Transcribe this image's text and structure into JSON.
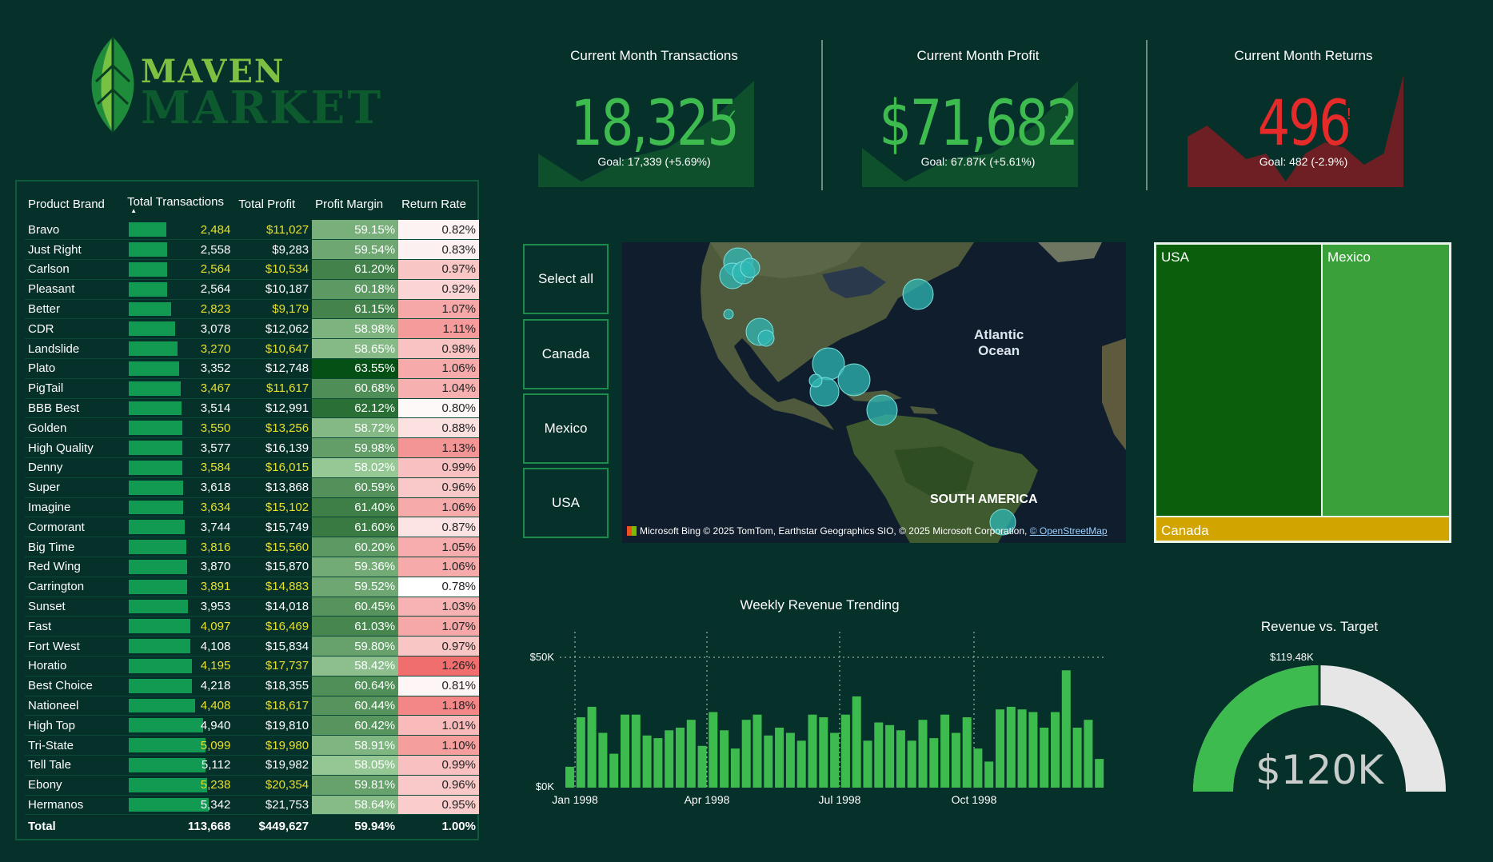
{
  "logo": {
    "word1": "MAVEN",
    "word2": "MARKET"
  },
  "table": {
    "headers": {
      "brand": "Product Brand",
      "transactions": "Total Transactions",
      "profit": "Total Profit",
      "margin": "Profit Margin",
      "return_rate": "Return Rate"
    },
    "sort_indicator": "▲",
    "rows": [
      {
        "brand": "Bravo",
        "transactions": "2,484",
        "profit": "$11,027",
        "margin": "59.15%",
        "return_rate": "0.82%",
        "tx_value": 2484,
        "margin_value": 59.15,
        "return_value": 0.82,
        "highlight": true
      },
      {
        "brand": "Just Right",
        "transactions": "2,558",
        "profit": "$9,283",
        "margin": "59.54%",
        "return_rate": "0.83%",
        "tx_value": 2558,
        "margin_value": 59.54,
        "return_value": 0.83,
        "highlight": false
      },
      {
        "brand": "Carlson",
        "transactions": "2,564",
        "profit": "$10,534",
        "margin": "61.20%",
        "return_rate": "0.97%",
        "tx_value": 2564,
        "margin_value": 61.2,
        "return_value": 0.97,
        "highlight": true
      },
      {
        "brand": "Pleasant",
        "transactions": "2,564",
        "profit": "$10,187",
        "margin": "60.18%",
        "return_rate": "0.92%",
        "tx_value": 2564,
        "margin_value": 60.18,
        "return_value": 0.92,
        "highlight": false
      },
      {
        "brand": "Better",
        "transactions": "2,823",
        "profit": "$9,179",
        "margin": "61.15%",
        "return_rate": "1.07%",
        "tx_value": 2823,
        "margin_value": 61.15,
        "return_value": 1.07,
        "highlight": true
      },
      {
        "brand": "CDR",
        "transactions": "3,078",
        "profit": "$12,062",
        "margin": "58.98%",
        "return_rate": "1.11%",
        "tx_value": 3078,
        "margin_value": 58.98,
        "return_value": 1.11,
        "highlight": false
      },
      {
        "brand": "Landslide",
        "transactions": "3,270",
        "profit": "$10,647",
        "margin": "58.65%",
        "return_rate": "0.98%",
        "tx_value": 3270,
        "margin_value": 58.65,
        "return_value": 0.98,
        "highlight": true
      },
      {
        "brand": "Plato",
        "transactions": "3,352",
        "profit": "$12,748",
        "margin": "63.55%",
        "return_rate": "1.06%",
        "tx_value": 3352,
        "margin_value": 63.55,
        "return_value": 1.06,
        "highlight": false
      },
      {
        "brand": "PigTail",
        "transactions": "3,467",
        "profit": "$11,617",
        "margin": "60.68%",
        "return_rate": "1.04%",
        "tx_value": 3467,
        "margin_value": 60.68,
        "return_value": 1.04,
        "highlight": true
      },
      {
        "brand": "BBB Best",
        "transactions": "3,514",
        "profit": "$12,991",
        "margin": "62.12%",
        "return_rate": "0.80%",
        "tx_value": 3514,
        "margin_value": 62.12,
        "return_value": 0.8,
        "highlight": false
      },
      {
        "brand": "Golden",
        "transactions": "3,550",
        "profit": "$13,256",
        "margin": "58.72%",
        "return_rate": "0.88%",
        "tx_value": 3550,
        "margin_value": 58.72,
        "return_value": 0.88,
        "highlight": true
      },
      {
        "brand": "High Quality",
        "transactions": "3,577",
        "profit": "$16,139",
        "margin": "59.98%",
        "return_rate": "1.13%",
        "tx_value": 3577,
        "margin_value": 59.98,
        "return_value": 1.13,
        "highlight": false
      },
      {
        "brand": "Denny",
        "transactions": "3,584",
        "profit": "$16,015",
        "margin": "58.02%",
        "return_rate": "0.99%",
        "tx_value": 3584,
        "margin_value": 58.02,
        "return_value": 0.99,
        "highlight": true
      },
      {
        "brand": "Super",
        "transactions": "3,618",
        "profit": "$13,868",
        "margin": "60.59%",
        "return_rate": "0.96%",
        "tx_value": 3618,
        "margin_value": 60.59,
        "return_value": 0.96,
        "highlight": false
      },
      {
        "brand": "Imagine",
        "transactions": "3,634",
        "profit": "$15,102",
        "margin": "61.40%",
        "return_rate": "1.06%",
        "tx_value": 3634,
        "margin_value": 61.4,
        "return_value": 1.06,
        "highlight": true
      },
      {
        "brand": "Cormorant",
        "transactions": "3,744",
        "profit": "$15,749",
        "margin": "61.60%",
        "return_rate": "0.87%",
        "tx_value": 3744,
        "margin_value": 61.6,
        "return_value": 0.87,
        "highlight": false
      },
      {
        "brand": "Big Time",
        "transactions": "3,816",
        "profit": "$15,560",
        "margin": "60.20%",
        "return_rate": "1.05%",
        "tx_value": 3816,
        "margin_value": 60.2,
        "return_value": 1.05,
        "highlight": true
      },
      {
        "brand": "Red Wing",
        "transactions": "3,870",
        "profit": "$15,870",
        "margin": "59.36%",
        "return_rate": "1.06%",
        "tx_value": 3870,
        "margin_value": 59.36,
        "return_value": 1.06,
        "highlight": false
      },
      {
        "brand": "Carrington",
        "transactions": "3,891",
        "profit": "$14,883",
        "margin": "59.52%",
        "return_rate": "0.78%",
        "tx_value": 3891,
        "margin_value": 59.52,
        "return_value": 0.78,
        "highlight": true
      },
      {
        "brand": "Sunset",
        "transactions": "3,953",
        "profit": "$14,018",
        "margin": "60.45%",
        "return_rate": "1.03%",
        "tx_value": 3953,
        "margin_value": 60.45,
        "return_value": 1.03,
        "highlight": false
      },
      {
        "brand": "Fast",
        "transactions": "4,097",
        "profit": "$16,469",
        "margin": "61.03%",
        "return_rate": "1.07%",
        "tx_value": 4097,
        "margin_value": 61.03,
        "return_value": 1.07,
        "highlight": true
      },
      {
        "brand": "Fort West",
        "transactions": "4,108",
        "profit": "$15,834",
        "margin": "59.80%",
        "return_rate": "0.97%",
        "tx_value": 4108,
        "margin_value": 59.8,
        "return_value": 0.97,
        "highlight": false
      },
      {
        "brand": "Horatio",
        "transactions": "4,195",
        "profit": "$17,737",
        "margin": "58.42%",
        "return_rate": "1.26%",
        "tx_value": 4195,
        "margin_value": 58.42,
        "return_value": 1.26,
        "highlight": true
      },
      {
        "brand": "Best Choice",
        "transactions": "4,218",
        "profit": "$18,355",
        "margin": "60.64%",
        "return_rate": "0.81%",
        "tx_value": 4218,
        "margin_value": 60.64,
        "return_value": 0.81,
        "highlight": false
      },
      {
        "brand": "Nationeel",
        "transactions": "4,408",
        "profit": "$18,617",
        "margin": "60.44%",
        "return_rate": "1.18%",
        "tx_value": 4408,
        "margin_value": 60.44,
        "return_value": 1.18,
        "highlight": true
      },
      {
        "brand": "High Top",
        "transactions": "4,940",
        "profit": "$19,810",
        "margin": "60.42%",
        "return_rate": "1.01%",
        "tx_value": 4940,
        "margin_value": 60.42,
        "return_value": 1.01,
        "highlight": false
      },
      {
        "brand": "Tri-State",
        "transactions": "5,099",
        "profit": "$19,980",
        "margin": "58.91%",
        "return_rate": "1.10%",
        "tx_value": 5099,
        "margin_value": 58.91,
        "return_value": 1.1,
        "highlight": true
      },
      {
        "brand": "Tell Tale",
        "transactions": "5,112",
        "profit": "$19,982",
        "margin": "58.05%",
        "return_rate": "0.99%",
        "tx_value": 5112,
        "margin_value": 58.05,
        "return_value": 0.99,
        "highlight": false
      },
      {
        "brand": "Ebony",
        "transactions": "5,238",
        "profit": "$20,354",
        "margin": "59.81%",
        "return_rate": "0.96%",
        "tx_value": 5238,
        "margin_value": 59.81,
        "return_value": 0.96,
        "highlight": true
      },
      {
        "brand": "Hermanos",
        "transactions": "5,342",
        "profit": "$21,753",
        "margin": "58.64%",
        "return_rate": "0.95%",
        "tx_value": 5342,
        "margin_value": 58.64,
        "return_value": 0.95,
        "highlight": false
      }
    ],
    "total": {
      "label": "Total",
      "transactions": "113,668",
      "profit": "$449,627",
      "margin": "59.94%",
      "return_rate": "1.00%"
    }
  },
  "kpis": {
    "transactions": {
      "title": "Current Month Transactions",
      "value": "18,325",
      "status": "✓",
      "goal": "Goal: 17,339 (+5.69%)",
      "trend": [
        0.3,
        0.05,
        0.25,
        0.35,
        0.6,
        0.95
      ]
    },
    "profit": {
      "title": "Current Month Profit",
      "value": "$71,682",
      "status": "✓",
      "goal": "Goal: 67.87K (+5.61%)",
      "trend": [
        0.35,
        0.05,
        0.25,
        0.3,
        0.55,
        0.95
      ]
    },
    "returns": {
      "title": "Current Month Returns",
      "value": "496",
      "status": "!",
      "goal": "Goal: 482 (-2.9%)",
      "trend": [
        0.45,
        0.55,
        0.4,
        0.25,
        0.3,
        0.05,
        0.3,
        0.4,
        0.35,
        0.2,
        0.3,
        1.0
      ]
    }
  },
  "slicer": {
    "items": [
      "Select all",
      "Canada",
      "Mexico",
      "USA"
    ]
  },
  "map": {
    "ocean_label_1": "Atlantic",
    "ocean_label_2": "Ocean",
    "continent_label": "SOUTH AMERICA",
    "brand_text": "Microsoft Bing",
    "attribution": "© 2025 TomTom, Earthstar Geographics SIO, © 2025 Microsoft Corporation,",
    "attribution_link": "© OpenStreetMap"
  },
  "treemap": {
    "items": [
      {
        "label": "USA",
        "color": "#0b5e0b"
      },
      {
        "label": "Mexico",
        "color": "#3aa03a"
      },
      {
        "label": "Canada",
        "color": "#d2a400"
      }
    ]
  },
  "weekly": {
    "title": "Weekly Revenue Trending",
    "y_ticks": [
      "$50K",
      "$0K"
    ],
    "x_ticks": [
      "Jan 1998",
      "Apr 1998",
      "Jul 1998",
      "Oct 1998"
    ]
  },
  "gauge": {
    "title": "Revenue vs. Target",
    "target_label": "$119.48K",
    "value_label": "$120K",
    "value": 120000,
    "target": 119480,
    "max": 238960,
    "fill_color": "#3dbb4f",
    "track_color": "#e6e6e6"
  },
  "chart_data": {
    "type": "bar",
    "title": "Weekly Revenue Trending",
    "xlabel": "",
    "ylabel": "",
    "ylim": [
      0,
      55000
    ],
    "x_ticks": [
      "Jan 1998",
      "Apr 1998",
      "Jul 1998",
      "Oct 1998"
    ],
    "values": [
      8000,
      27000,
      31000,
      21000,
      13000,
      28000,
      28000,
      20000,
      19000,
      22000,
      23000,
      26000,
      16000,
      29000,
      22000,
      15000,
      26000,
      28000,
      20000,
      23000,
      21000,
      18000,
      28000,
      27000,
      21000,
      28000,
      35000,
      18000,
      25000,
      24000,
      22000,
      18000,
      26000,
      19000,
      28000,
      21000,
      27000,
      15000,
      10000,
      30000,
      31000,
      30000,
      29000,
      23000,
      29000,
      45000,
      23000,
      26000,
      11000
    ]
  }
}
